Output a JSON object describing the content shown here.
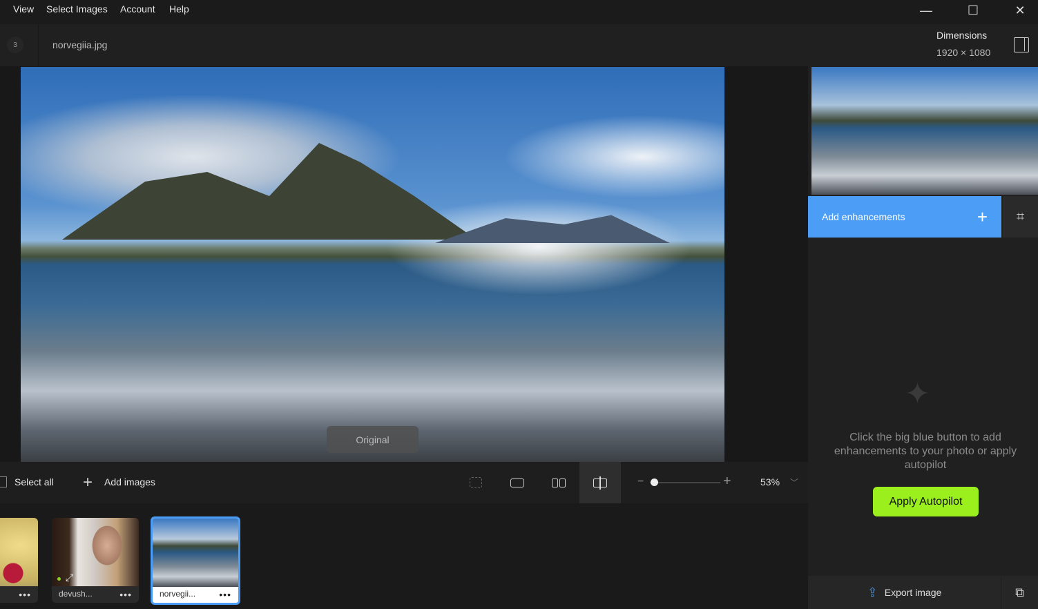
{
  "menu": {
    "items": [
      "View",
      "Select Images",
      "Account",
      "Help"
    ]
  },
  "window": {
    "minimize": "—",
    "maximize": "☐",
    "close": "✕"
  },
  "header": {
    "count": "3",
    "filename": "norvegiia.jpg",
    "dimensions_label": "Dimensions",
    "dimensions_value": "1920 × 1080"
  },
  "canvas": {
    "original_label": "Original"
  },
  "toolbar": {
    "select_all": "Select all",
    "add_images": "Add images",
    "zoom": "53%",
    "zoom_level": 0.08
  },
  "thumbnails": [
    {
      "label": "",
      "selected": false
    },
    {
      "label": "devush...",
      "selected": false
    },
    {
      "label": "norvegii...",
      "selected": true
    }
  ],
  "panel": {
    "add_enhancements": "Add enhancements",
    "hint": "Click the big blue button to add enhancements to your photo or apply autopilot",
    "apply_autopilot": "Apply Autopilot",
    "export": "Export image"
  },
  "colors": {
    "accent": "#4b9df5",
    "autopilot": "#9bef1c"
  }
}
